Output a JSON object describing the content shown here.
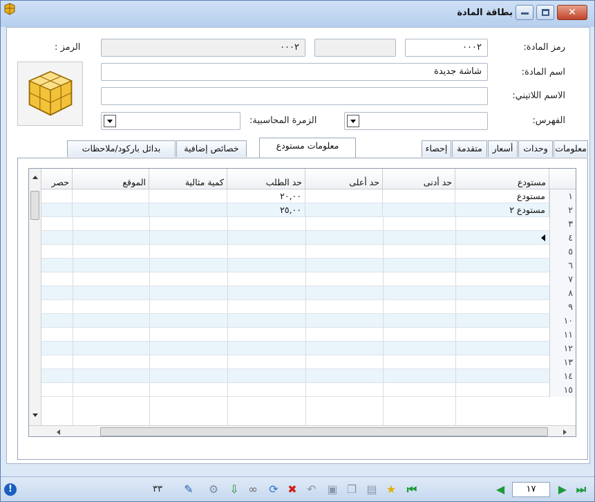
{
  "window": {
    "title": "بطاقة المادة"
  },
  "form": {
    "code_label": "رمز المادة:",
    "code_value": "٠٠٠٢",
    "code2_label": "الرمز :",
    "code2_value": "٠٠٠٢",
    "name_label": "اسم المادة:",
    "name_value": "شاشة جديدة",
    "latin_label": "الاسم اللاتيني:",
    "latin_value": "",
    "index_label": "الفهرس:",
    "index_value": "",
    "acc_group_label": "الزمرة المحاسبية:",
    "acc_group_value": ""
  },
  "tabs": [
    {
      "label": "معلومات"
    },
    {
      "label": "وحدات"
    },
    {
      "label": "أسعار"
    },
    {
      "label": "متقدمة"
    },
    {
      "label": "إحصاء"
    },
    {
      "label": "معلومات مستودع"
    },
    {
      "label": "خصائص إضافية"
    },
    {
      "label": "بدائل باركود/ملاحظات"
    }
  ],
  "grid": {
    "columns": [
      "مستودع",
      "حد أدنى",
      "حد أعلى",
      "حد الطلب",
      "كمية مثالية",
      "الموقع",
      "حصر"
    ],
    "rows": [
      {
        "num": "١",
        "store": "مستودع",
        "min": "",
        "max": "",
        "order": "٢٠,٠٠",
        "ideal": "",
        "loc": ""
      },
      {
        "num": "٢",
        "store": "مستودع ٢",
        "min": "",
        "max": "",
        "order": "٢٥,٠٠",
        "ideal": "",
        "loc": ""
      },
      {
        "num": "٣",
        "store": "",
        "min": "",
        "max": "",
        "order": "",
        "ideal": "",
        "loc": ""
      },
      {
        "num": "٤",
        "store": "",
        "min": "",
        "max": "",
        "order": "",
        "ideal": "",
        "loc": ""
      },
      {
        "num": "٥",
        "store": "",
        "min": "",
        "max": "",
        "order": "",
        "ideal": "",
        "loc": ""
      },
      {
        "num": "٦",
        "store": "",
        "min": "",
        "max": "",
        "order": "",
        "ideal": "",
        "loc": ""
      },
      {
        "num": "٧",
        "store": "",
        "min": "",
        "max": "",
        "order": "",
        "ideal": "",
        "loc": ""
      },
      {
        "num": "٨",
        "store": "",
        "min": "",
        "max": "",
        "order": "",
        "ideal": "",
        "loc": ""
      },
      {
        "num": "٩",
        "store": "",
        "min": "",
        "max": "",
        "order": "",
        "ideal": "",
        "loc": ""
      },
      {
        "num": "١٠",
        "store": "",
        "min": "",
        "max": "",
        "order": "",
        "ideal": "",
        "loc": ""
      },
      {
        "num": "١١",
        "store": "",
        "min": "",
        "max": "",
        "order": "",
        "ideal": "",
        "loc": ""
      },
      {
        "num": "١٢",
        "store": "",
        "min": "",
        "max": "",
        "order": "",
        "ideal": "",
        "loc": ""
      },
      {
        "num": "١٣",
        "store": "",
        "min": "",
        "max": "",
        "order": "",
        "ideal": "",
        "loc": ""
      },
      {
        "num": "١٤",
        "store": "",
        "min": "",
        "max": "",
        "order": "",
        "ideal": "",
        "loc": ""
      },
      {
        "num": "١٥",
        "store": "",
        "min": "",
        "max": "",
        "order": "",
        "ideal": "",
        "loc": ""
      }
    ]
  },
  "statusbar": {
    "page_value": "١٧",
    "count_value": "٣٣"
  }
}
